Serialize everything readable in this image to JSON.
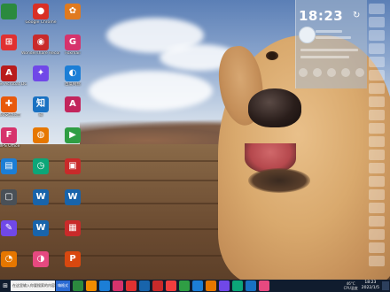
{
  "desktop": {
    "icons": [
      {
        "label": "",
        "glyph": "",
        "color": "#2b8a3e"
      },
      {
        "label": "Google Chrome",
        "glyph": "●",
        "color": "#d93025"
      },
      {
        "label": "",
        "glyph": "✿",
        "color": "#e07a1f"
      },
      {
        "label": "",
        "glyph": "⊞",
        "color": "#e03131"
      },
      {
        "label": "Wondershare Recorder",
        "glyph": "◉",
        "color": "#c92a2a"
      },
      {
        "label": "Foxmail",
        "glyph": "G",
        "color": "#d6336c"
      },
      {
        "label": "Adobe Acrobat DC",
        "glyph": "A",
        "color": "#b91c1c"
      },
      {
        "label": "",
        "glyph": "✦",
        "color": "#7048e8"
      },
      {
        "label": "百度网盘",
        "glyph": "◐",
        "color": "#1c7ed6"
      },
      {
        "label": "360安全卫士",
        "glyph": "✚",
        "color": "#e8590c"
      },
      {
        "label": "知",
        "glyph": "知",
        "color": "#1971c2"
      },
      {
        "label": "",
        "glyph": "A",
        "color": "#c2255c"
      },
      {
        "label": "WPS Office",
        "glyph": "F",
        "color": "#d6336c"
      },
      {
        "label": "",
        "glyph": "◍",
        "color": "#e67700"
      },
      {
        "label": "",
        "glyph": "▶",
        "color": "#2f9e44"
      },
      {
        "label": "",
        "glyph": "▤",
        "color": "#1c7ed6"
      },
      {
        "label": "",
        "glyph": "◷",
        "color": "#0ca678"
      },
      {
        "label": "",
        "glyph": "▣",
        "color": "#c92a2a"
      },
      {
        "label": "",
        "glyph": "▢",
        "color": "#495057"
      },
      {
        "label": "",
        "glyph": "W",
        "color": "#1864ab"
      },
      {
        "label": "",
        "glyph": "W",
        "color": "#1864ab"
      },
      {
        "label": "",
        "glyph": "✎",
        "color": "#7048e8"
      },
      {
        "label": "",
        "glyph": "W",
        "color": "#1864ab"
      },
      {
        "label": "",
        "glyph": "▦",
        "color": "#c92a2a"
      },
      {
        "label": "",
        "glyph": "◔",
        "color": "#e67700"
      },
      {
        "label": "",
        "glyph": "◑",
        "color": "#e64980"
      },
      {
        "label": "",
        "glyph": "P",
        "color": "#d9480f"
      }
    ]
  },
  "weather_widget": {
    "time": "18:23",
    "date": "",
    "refresh_glyph": "↻"
  },
  "taskbar": {
    "start_glyph": "⊞",
    "search_placeholder": "在这里输入你要搜索的内容",
    "active_button": "嗨格式",
    "apps": [
      "#2b8a3e",
      "#f08c00",
      "#1c7ed6",
      "#d6336c",
      "#e03131",
      "#1864ab",
      "#c92a2a",
      "#f03e3e",
      "#2f9e44",
      "#1c7ed6",
      "#e67700",
      "#7048e8",
      "#0ca678",
      "#1971c2",
      "#e64980"
    ],
    "tray_weather": "46°C\nCPU温度",
    "clock": "18:23\n2022/1/5"
  }
}
